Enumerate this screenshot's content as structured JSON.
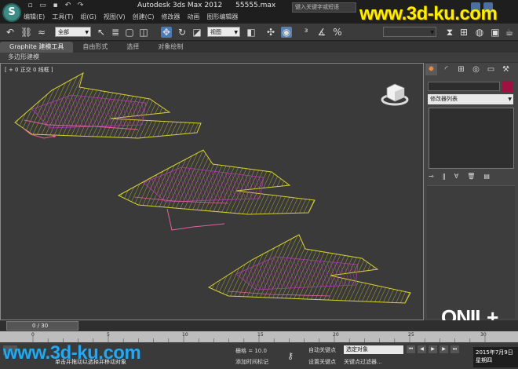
{
  "app": {
    "logo_letter": "S",
    "title": "Autodesk 3ds Max  2012",
    "file": "55555.max",
    "search_placeholder": "键入关键字或短语"
  },
  "menu": [
    "编辑(E)",
    "工具(T)",
    "组(G)",
    "视图(V)",
    "创建(C)",
    "修改器",
    "动画",
    "图形编辑器"
  ],
  "toolbar": {
    "selection_filter": "全部",
    "reference_coord": "视图"
  },
  "ribbon": {
    "tabs": [
      "Graphite 建模工具",
      "自由形式",
      "选择",
      "对象绘制"
    ],
    "sub_label": "多边形建模"
  },
  "viewport": {
    "label": "[ + 0 正交 0 线框 ]"
  },
  "command_panel": {
    "modifier_list": "修改器列表",
    "color_swatch": "#a01040"
  },
  "timeline": {
    "frame_counter": "0 / 30",
    "ticks": [
      "0",
      "5",
      "10",
      "15",
      "20",
      "25",
      "30"
    ]
  },
  "status": {
    "prompt": "单击并拖动以选择并移动对象",
    "grid": "栅格 = 10.0",
    "add_time_tag": "添加时间标记",
    "auto_key": "自动关键点",
    "set_key": "设置关键点",
    "selection_set": "选定对象",
    "key_filters": "关键点过滤器..."
  },
  "datetime": {
    "date": "2015年7月9日",
    "weekday": "星期四"
  },
  "watermarks": {
    "top": "www.3d-ku.com",
    "bottom": "www.3d-ku.com",
    "corner": "ONIL+"
  },
  "colors": {
    "wire_yellow": "#d8d230",
    "wire_magenta": "#b03ab0",
    "wire_pink": "#e060a0",
    "viewport_bg": "#3a3a3a"
  }
}
